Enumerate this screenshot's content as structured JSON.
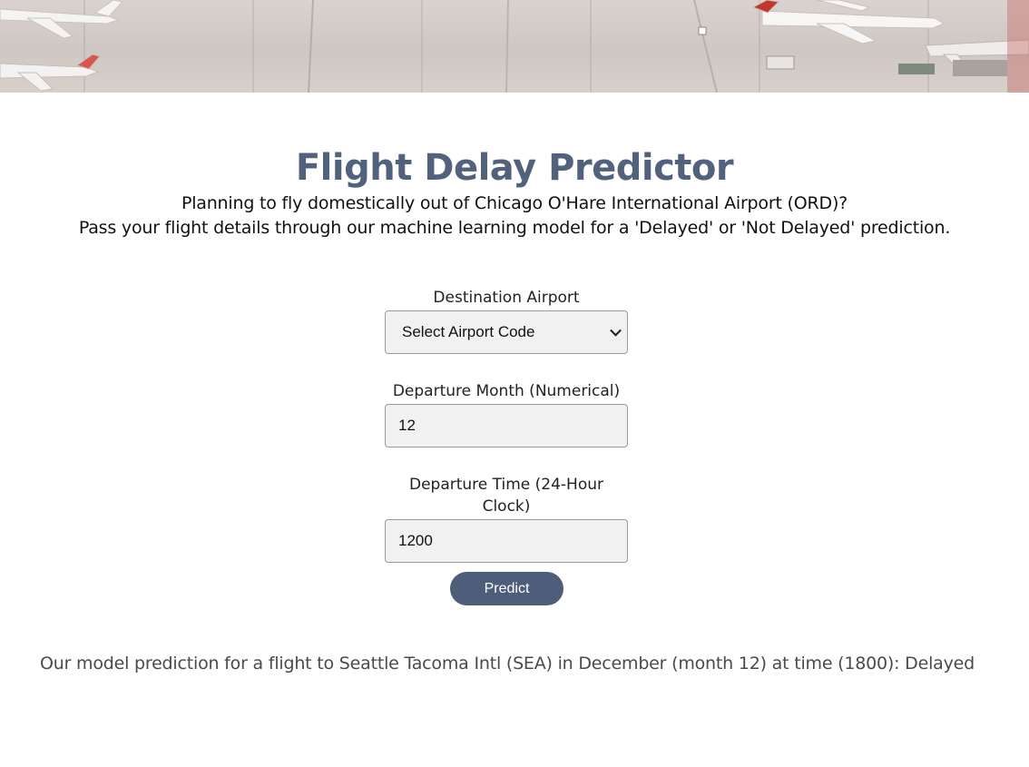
{
  "app": {
    "title": "Flight Delay Predictor"
  },
  "intro": {
    "line1": "Planning to fly domestically out of Chicago O'Hare International Airport (ORD)?",
    "line2": "Pass your flight details through our machine learning model for a 'Delayed' or 'Not Delayed' prediction."
  },
  "form": {
    "destination": {
      "label": "Destination Airport",
      "selected": "Select Airport Code"
    },
    "month": {
      "label": "Departure Month (Numerical)",
      "value": "12"
    },
    "time": {
      "label": "Departure Time (24-Hour Clock)",
      "value": "1200"
    },
    "submit_label": "Predict"
  },
  "result": {
    "text": "Our model prediction for a flight to Seattle Tacoma Intl (SEA) in December (month 12) at time (1800): Delayed"
  },
  "colors": {
    "title": "#53627c",
    "button": "#4e5e7a",
    "result_text": "#4a4a4a"
  },
  "icons": {
    "select_caret": "chevron-down-icon",
    "banner": "airport-tarmac-photo"
  }
}
